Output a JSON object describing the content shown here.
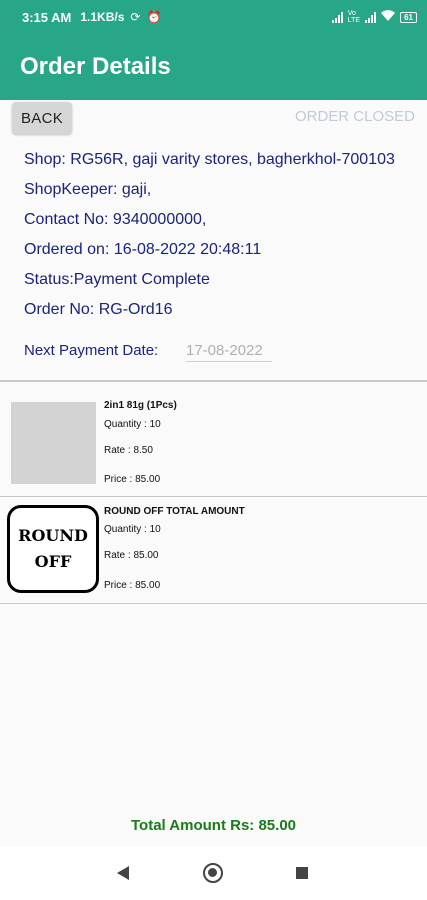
{
  "status_bar": {
    "time": "3:15 AM",
    "speed": "1.1KB/s",
    "battery": "61",
    "lte_label": "Vo\nLTE"
  },
  "app": {
    "title": "Order Details"
  },
  "actions": {
    "back_label": "BACK",
    "order_status_label": "ORDER CLOSED"
  },
  "order": {
    "shop": "Shop: RG56R, gaji varity stores, bagherkhol-700103",
    "shopkeeper": "ShopKeeper: gaji,",
    "contact": "Contact No: 9340000000,",
    "ordered_on": "Ordered on: 16-08-2022 20:48:11",
    "status": "Status:Payment Complete",
    "order_no": "Order No: RG-Ord16",
    "next_payment_label": "Next Payment Date:",
    "next_payment_value": "17-08-2022"
  },
  "items": [
    {
      "name": "2in1 81g (1Pcs)",
      "quantity": "Quantity : 10",
      "rate": "Rate : 8.50",
      "price": "Price : 85.00"
    },
    {
      "name": "ROUND OFF TOTAL AMOUNT",
      "image_text_line1": "ROUND",
      "image_text_line2": "OFF",
      "quantity": "Quantity : 10",
      "rate": "Rate : 85.00",
      "price": "Price : 85.00"
    }
  ],
  "total": "Total Amount Rs: 85.00",
  "colors": {
    "primary": "#28a688",
    "info_text": "#1a237e",
    "total_text": "#1b7a1b"
  }
}
